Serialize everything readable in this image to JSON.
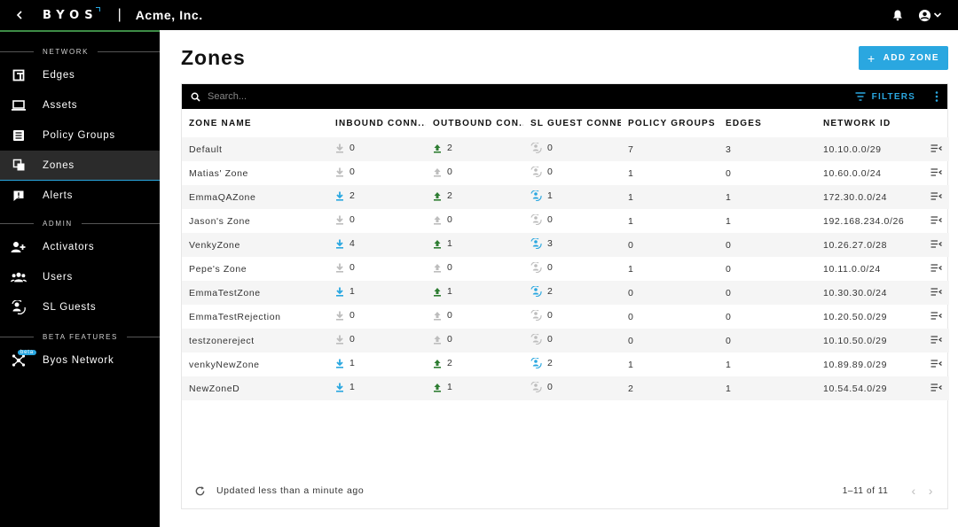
{
  "header": {
    "logo_text": "BYOS",
    "separator": "|",
    "org_name": "Acme, Inc."
  },
  "sidebar": {
    "sections": [
      {
        "label": "NETWORK",
        "items": [
          {
            "label": "Edges",
            "icon": "edges-icon"
          },
          {
            "label": "Assets",
            "icon": "laptop-icon"
          },
          {
            "label": "Policy Groups",
            "icon": "policy-icon"
          },
          {
            "label": "Zones",
            "icon": "zones-icon",
            "active": true
          },
          {
            "label": "Alerts",
            "icon": "alert-icon"
          }
        ]
      },
      {
        "label": "ADMIN",
        "items": [
          {
            "label": "Activators",
            "icon": "add-user-icon"
          },
          {
            "label": "Users",
            "icon": "users-icon"
          },
          {
            "label": "SL Guests",
            "icon": "guests-icon"
          }
        ]
      },
      {
        "label": "BETA FEATURES",
        "items": [
          {
            "label": "Byos Network",
            "icon": "network-icon",
            "badge": "beta"
          }
        ]
      }
    ]
  },
  "main": {
    "title": "Zones",
    "add_button": "ADD ZONE",
    "search_placeholder": "Search...",
    "filters_label": "FILTERS",
    "columns": [
      "ZONE NAME",
      "INBOUND CONN...",
      "OUTBOUND CON...",
      "SL GUEST CONNE...",
      "POLICY GROUPS",
      "EDGES",
      "NETWORK ID"
    ],
    "rows": [
      {
        "name": "Default",
        "inbound": "0",
        "outbound": "2",
        "guest": "0",
        "policy": "7",
        "edges": "3",
        "network": "10.10.0.0/29"
      },
      {
        "name": "Matias' Zone",
        "inbound": "0",
        "outbound": "0",
        "guest": "0",
        "policy": "1",
        "edges": "0",
        "network": "10.60.0.0/24"
      },
      {
        "name": "EmmaQAZone",
        "inbound": "2",
        "outbound": "2",
        "guest": "1",
        "policy": "1",
        "edges": "1",
        "network": "172.30.0.0/24"
      },
      {
        "name": "Jason's Zone",
        "inbound": "0",
        "outbound": "0",
        "guest": "0",
        "policy": "1",
        "edges": "1",
        "network": "192.168.234.0/26"
      },
      {
        "name": "VenkyZone",
        "inbound": "4",
        "outbound": "1",
        "guest": "3",
        "policy": "0",
        "edges": "0",
        "network": "10.26.27.0/28"
      },
      {
        "name": "Pepe's Zone",
        "inbound": "0",
        "outbound": "0",
        "guest": "0",
        "policy": "1",
        "edges": "0",
        "network": "10.11.0.0/24"
      },
      {
        "name": "EmmaTestZone",
        "inbound": "1",
        "outbound": "1",
        "guest": "2",
        "policy": "0",
        "edges": "0",
        "network": "10.30.30.0/24"
      },
      {
        "name": "EmmaTestRejection",
        "inbound": "0",
        "outbound": "0",
        "guest": "0",
        "policy": "0",
        "edges": "0",
        "network": "10.20.50.0/29"
      },
      {
        "name": "testzonereject",
        "inbound": "0",
        "outbound": "0",
        "guest": "0",
        "policy": "0",
        "edges": "0",
        "network": "10.10.50.0/29"
      },
      {
        "name": "venkyNewZone",
        "inbound": "1",
        "outbound": "2",
        "guest": "2",
        "policy": "1",
        "edges": "1",
        "network": "10.89.89.0/29"
      },
      {
        "name": "NewZoneD",
        "inbound": "1",
        "outbound": "1",
        "guest": "0",
        "policy": "2",
        "edges": "1",
        "network": "10.54.54.0/29"
      }
    ],
    "footer": {
      "updated_text": "Updated less than a minute ago",
      "pagination": "1–11 of 11"
    }
  },
  "colors": {
    "accent_blue": "#2aa7e0",
    "accent_green": "#2e7d32",
    "inactive_gray": "#bdbdbd"
  }
}
